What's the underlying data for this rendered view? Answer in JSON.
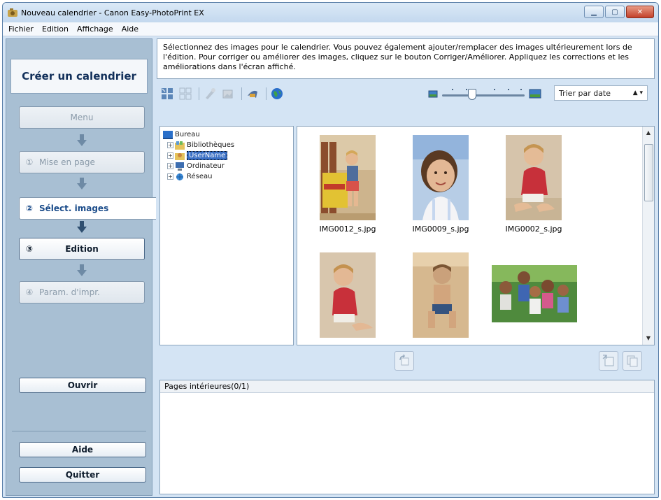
{
  "window": {
    "title": "Nouveau calendrier - Canon Easy-PhotoPrint EX",
    "min_label": "▁",
    "max_label": "▢",
    "close_label": "✕"
  },
  "menubar": [
    "Fichier",
    "Edition",
    "Affichage",
    "Aide"
  ],
  "sidebar": {
    "title": "Créer un calendrier",
    "menu_label": "Menu",
    "steps": [
      {
        "num": "①",
        "label": "Mise en page"
      },
      {
        "num": "②",
        "label": "Sélect. images"
      },
      {
        "num": "③",
        "label": "Edition"
      },
      {
        "num": "④",
        "label": "Param. d'impr."
      }
    ],
    "open_label": "Ouvrir",
    "help_label": "Aide",
    "quit_label": "Quitter"
  },
  "instructions": "Sélectionnez des images pour le calendrier. Vous pouvez également ajouter/remplacer des images ultérieurement lors de l'édition. Pour corriger ou améliorer des images, cliquez sur le bouton Corriger/Améliorer. Appliquez les corrections et les améliorations dans l'écran affiché.",
  "toolbar": {
    "sort_label": "Trier par date",
    "sort_arrows": "▲ ▾"
  },
  "zoom_level": 0.35,
  "tree": {
    "root": "Bureau",
    "items": [
      "Bibliothèques",
      "UserName",
      "Ordinateur",
      "Réseau"
    ]
  },
  "images": [
    {
      "name": "IMG0012_s.jpg"
    },
    {
      "name": "IMG0009_s.jpg"
    },
    {
      "name": "IMG0002_s.jpg"
    },
    {
      "name": ""
    },
    {
      "name": ""
    },
    {
      "name": ""
    }
  ],
  "pages_panel": {
    "header": "Pages intérieures(0/1)"
  },
  "colors": {
    "accent": "#1b4c8a",
    "selection": "#3a6fc4",
    "sidebar_bg": "#a8bfd3",
    "main_bg": "#d4e4f4"
  }
}
